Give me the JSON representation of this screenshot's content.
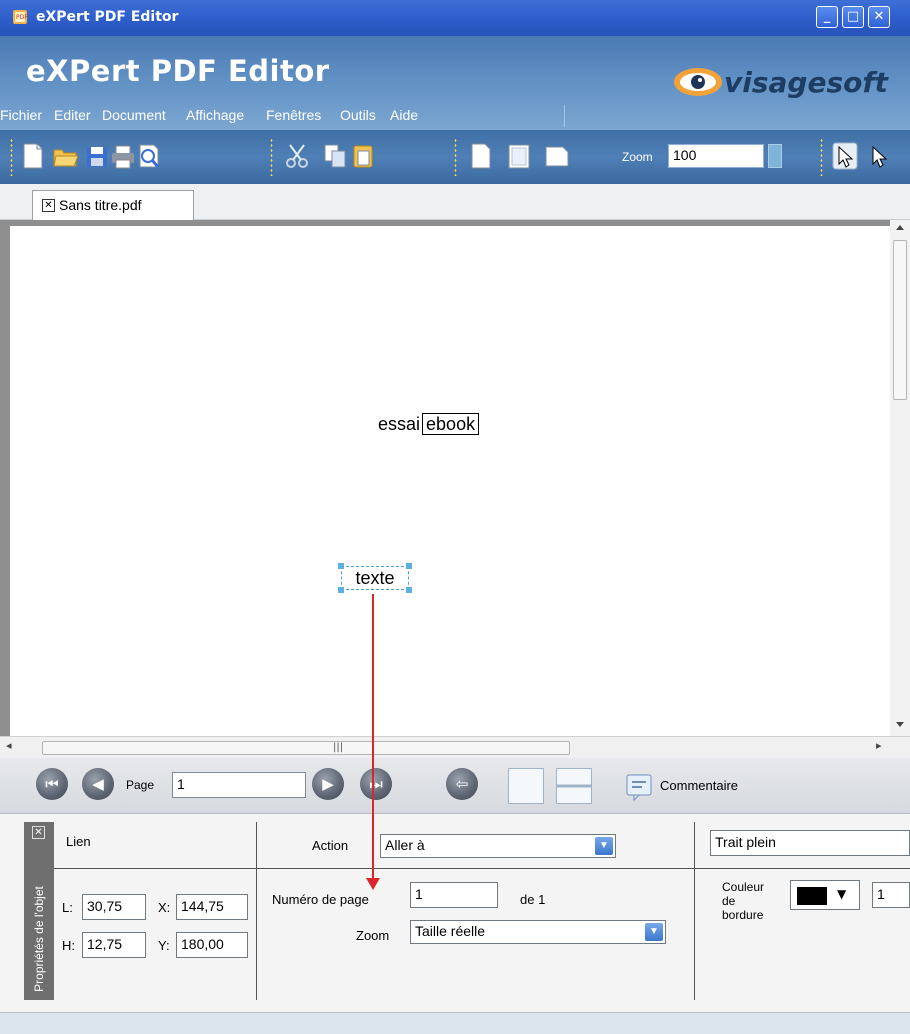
{
  "window": {
    "title": "eXPert PDF Editor",
    "controls": [
      "minimize-icon",
      "maximize-icon",
      "close-icon"
    ]
  },
  "header": {
    "app_title": "eXPert PDF Editor",
    "brand": "visagesoft"
  },
  "menu": {
    "items": [
      "Fichier",
      "Editer",
      "Document",
      "Affichage",
      "Fenêtres",
      "Outils",
      "Aide"
    ]
  },
  "toolbar": {
    "icons": [
      "new-document-icon",
      "open-folder-icon",
      "save-icon",
      "print-icon",
      "print-preview-icon",
      "cut-icon",
      "copy-icon",
      "paste-icon",
      "page-portrait-icon",
      "page-single-icon",
      "page-landscape-icon",
      "select-arrow-icon",
      "select-text-arrow-icon"
    ],
    "zoom_label": "Zoom",
    "zoom_value": "100"
  },
  "tabs": [
    {
      "label": "Sans titre.pdf"
    }
  ],
  "document": {
    "text_plain": "essai",
    "text_boxed": "ebook",
    "field_text": "texte"
  },
  "nav": {
    "page_label": "Page",
    "page_value": "1",
    "comment_label": "Commentaire"
  },
  "properties": {
    "panel_title": "Propriétés de l'objet",
    "type": "Lien",
    "L_label": "L:",
    "L_value": "30,75",
    "X_label": "X:",
    "X_value": "144,75",
    "H_label": "H:",
    "H_value": "12,75",
    "Y_label": "Y:",
    "Y_value": "180,00",
    "action_label": "Action",
    "action_value": "Aller à",
    "page_number_label": "Numéro de page",
    "page_number_value": "1",
    "page_of": "de 1",
    "zoom_label": "Zoom",
    "zoom_value": "Taille réelle",
    "border_style": "Trait plein",
    "border_color_label_1": "Couleur",
    "border_color_label_2": "de",
    "border_color_label_3": "bordure",
    "border_width": "1"
  },
  "colors": {
    "titlebar": "#2f5fcc",
    "header": "#5f8fc3",
    "toolbar": "#4e7fb6",
    "annotation_arrow": "#d9262a",
    "selection": "#5bb0e0"
  }
}
